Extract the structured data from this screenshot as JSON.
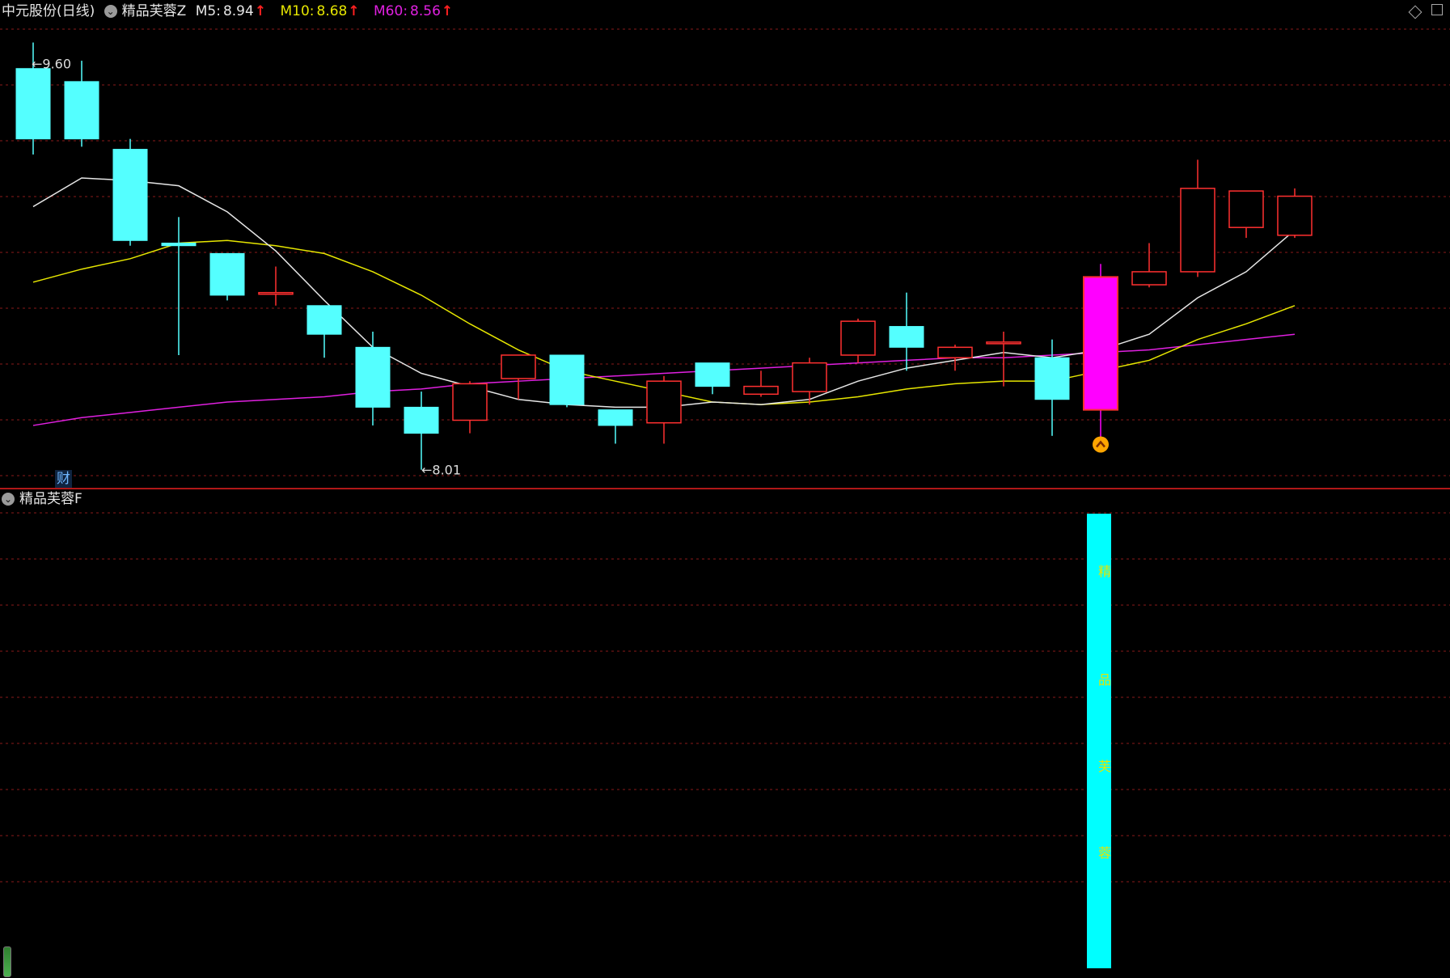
{
  "header": {
    "stock_name": "中元股份(日线)",
    "indicator_main": "精品芙蓉Z",
    "ma5_label": "M5:",
    "ma5_value": "8.94",
    "ma10_label": "M10:",
    "ma10_value": "8.68",
    "ma60_label": "M60:",
    "ma60_value": "8.56",
    "up_arrow": "↑"
  },
  "sub_panel": {
    "indicator_name": "精品芙蓉F",
    "bar_chars": [
      "精",
      "品",
      "芙",
      "蓉"
    ]
  },
  "badge": {
    "label": "财"
  },
  "colors": {
    "up": "#ff3030",
    "down": "#54ffff",
    "highlight": "#ff00ff",
    "ma5": "#e6e6e6",
    "ma10": "#e6e600",
    "ma60": "#e020e0",
    "grid": "#8a1a1a",
    "separator": "#b01818",
    "sub_bar": "#00ffff",
    "sub_text": "#e6e600",
    "signal": "#ffa500"
  },
  "chart_data": {
    "type": "candlestick",
    "ylim": [
      7.95,
      9.72
    ],
    "high_marker": {
      "label": "9.60",
      "value": 9.6
    },
    "low_marker": {
      "label": "8.01",
      "value": 8.01
    },
    "candles": [
      {
        "o": 9.55,
        "h": 9.65,
        "l": 9.22,
        "c": 9.28
      },
      {
        "o": 9.5,
        "h": 9.58,
        "l": 9.25,
        "c": 9.28
      },
      {
        "o": 9.24,
        "h": 9.28,
        "l": 8.87,
        "c": 8.89
      },
      {
        "o": 8.88,
        "h": 8.98,
        "l": 8.45,
        "c": 8.87
      },
      {
        "o": 8.84,
        "h": 8.84,
        "l": 8.66,
        "c": 8.68
      },
      {
        "o": 8.69,
        "h": 8.79,
        "l": 8.64,
        "c": 8.69
      },
      {
        "o": 8.64,
        "h": 8.64,
        "l": 8.44,
        "c": 8.53
      },
      {
        "o": 8.48,
        "h": 8.54,
        "l": 8.18,
        "c": 8.25
      },
      {
        "o": 8.25,
        "h": 8.31,
        "l": 8.01,
        "c": 8.15
      },
      {
        "o": 8.2,
        "h": 8.35,
        "l": 8.15,
        "c": 8.34
      },
      {
        "o": 8.36,
        "h": 8.45,
        "l": 8.28,
        "c": 8.45
      },
      {
        "o": 8.45,
        "h": 8.45,
        "l": 8.25,
        "c": 8.26
      },
      {
        "o": 8.24,
        "h": 8.24,
        "l": 8.11,
        "c": 8.18
      },
      {
        "o": 8.19,
        "h": 8.37,
        "l": 8.11,
        "c": 8.35
      },
      {
        "o": 8.42,
        "h": 8.42,
        "l": 8.3,
        "c": 8.33
      },
      {
        "o": 8.3,
        "h": 8.39,
        "l": 8.29,
        "c": 8.33
      },
      {
        "o": 8.31,
        "h": 8.44,
        "l": 8.26,
        "c": 8.42
      },
      {
        "o": 8.45,
        "h": 8.59,
        "l": 8.42,
        "c": 8.58
      },
      {
        "o": 8.56,
        "h": 8.69,
        "l": 8.39,
        "c": 8.48
      },
      {
        "o": 8.44,
        "h": 8.49,
        "l": 8.39,
        "c": 8.48
      },
      {
        "o": 8.5,
        "h": 8.54,
        "l": 8.33,
        "c": 8.5
      },
      {
        "o": 8.44,
        "h": 8.51,
        "l": 8.14,
        "c": 8.28
      },
      {
        "o": 8.24,
        "h": 8.8,
        "l": 8.11,
        "c": 8.75,
        "highlight": true
      },
      {
        "o": 8.72,
        "h": 8.88,
        "l": 8.71,
        "c": 8.77
      },
      {
        "o": 8.77,
        "h": 9.2,
        "l": 8.75,
        "c": 9.09
      },
      {
        "o": 8.94,
        "h": 9.08,
        "l": 8.9,
        "c": 9.08
      },
      {
        "o": 8.91,
        "h": 9.09,
        "l": 8.9,
        "c": 9.06
      }
    ],
    "ma5": [
      9.02,
      9.13,
      9.12,
      9.1,
      9.0,
      8.85,
      8.66,
      8.48,
      8.38,
      8.33,
      8.28,
      8.26,
      8.25,
      8.25,
      8.27,
      8.26,
      8.28,
      8.35,
      8.4,
      8.43,
      8.46,
      8.44,
      8.47,
      8.53,
      8.67,
      8.77,
      8.93
    ],
    "ma10": [
      8.73,
      8.78,
      8.82,
      8.88,
      8.89,
      8.87,
      8.84,
      8.77,
      8.68,
      8.57,
      8.47,
      8.39,
      8.35,
      8.31,
      8.27,
      8.26,
      8.27,
      8.29,
      8.32,
      8.34,
      8.35,
      8.35,
      8.39,
      8.43,
      8.51,
      8.57,
      8.64
    ],
    "ma60": [
      8.18,
      8.21,
      8.23,
      8.25,
      8.27,
      8.28,
      8.29,
      8.31,
      8.32,
      8.34,
      8.35,
      8.36,
      8.37,
      8.38,
      8.39,
      8.4,
      8.41,
      8.42,
      8.43,
      8.44,
      8.44,
      8.45,
      8.46,
      8.47,
      8.49,
      8.51,
      8.53
    ],
    "sub_signals": [
      22
    ],
    "price_signals": [
      22
    ]
  }
}
